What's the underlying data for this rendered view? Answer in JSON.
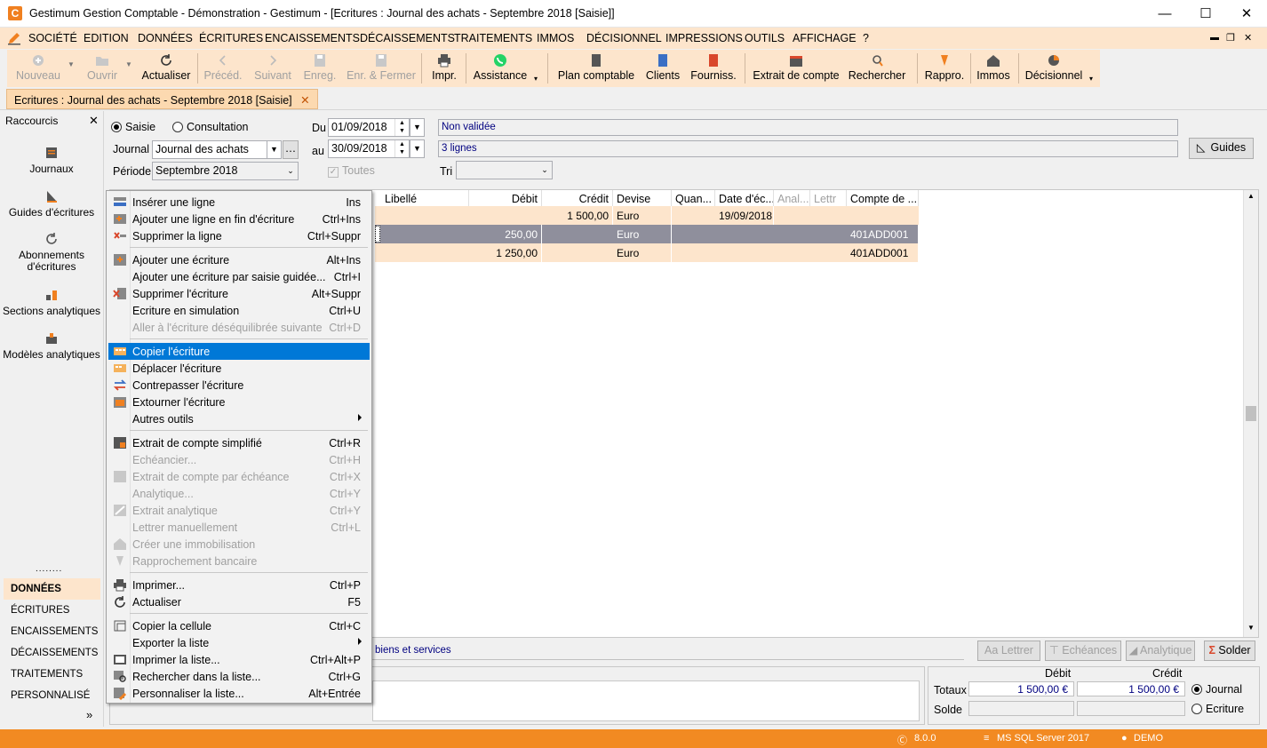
{
  "window": {
    "title": "Gestimum Gestion Comptable - Démonstration - Gestimum - [Ecritures : Journal des achats - Septembre 2018 [Saisie]]",
    "minimize": "—",
    "maximize": "☐",
    "close": "✕"
  },
  "menu": {
    "items": [
      "SOCIÉTÉ",
      "EDITION",
      "DONNÉES",
      "ÉCRITURES",
      "ENCAISSEMENTS",
      "DÉCAISSEMENTS",
      "TRAITEMENTS",
      "IMMOS",
      "DÉCISIONNEL",
      "IMPRESSIONS",
      "OUTILS",
      "AFFICHAGE",
      "?"
    ],
    "right_controls": [
      "✕",
      "❐",
      "✕"
    ]
  },
  "toolbar": {
    "nouveau": "Nouveau",
    "ouvrir": "Ouvrir",
    "actualiser": "Actualiser",
    "preced": "Précéd.",
    "suivant": "Suivant",
    "enreg": "Enreg.",
    "enreg_fermer": "Enr. & Fermer",
    "impr": "Impr.",
    "assistance": "Assistance",
    "plan_comptable": "Plan comptable",
    "clients": "Clients",
    "fourniss": "Fourniss.",
    "extrait": "Extrait de compte",
    "rechercher": "Rechercher",
    "rappro": "Rappro.",
    "immos": "Immos",
    "decisionnel": "Décisionnel"
  },
  "doc_tab": {
    "label": "Ecritures : Journal des achats - Septembre 2018 [Saisie]",
    "close": "✕"
  },
  "shortcuts": {
    "header": "Raccourcis",
    "close": "✕",
    "items": [
      "Journaux",
      "Guides d'écritures",
      "Abonnements d'écritures",
      "Sections analytiques",
      "Modèles analytiques"
    ],
    "dots": "........",
    "nav": [
      "DONNÉES",
      "ÉCRITURES",
      "ENCAISSEMENTS",
      "DÉCAISSEMENTS",
      "TRAITEMENTS",
      "PERSONNALISÉ"
    ],
    "more": "»"
  },
  "form": {
    "saisie": "Saisie",
    "consultation": "Consultation",
    "journal_label": "Journal",
    "journal_value": "Journal des achats",
    "periode_label": "Période",
    "periode_value": "Septembre 2018",
    "du_label": "Du",
    "du_value": "01/09/2018",
    "au_label": "au",
    "au_value": "30/09/2018",
    "toutes": "Toutes",
    "tri_label": "Tri",
    "status": "Non validée",
    "lines": "3 lignes",
    "guides": "Guides"
  },
  "grid": {
    "columns": [
      "Libellé",
      "Débit",
      "Crédit",
      "Devise",
      "Quan...",
      "Date d'éc...",
      "Anal...",
      "Lettr",
      "Compte de ..."
    ],
    "rows": [
      {
        "debit": "",
        "credit": "1 500,00",
        "devise": "Euro",
        "date": "19/09/2018",
        "compte": ""
      },
      {
        "debit": "250,00",
        "credit": "",
        "devise": "Euro",
        "date": "",
        "compte": "401ADD001"
      },
      {
        "debit": "1 250,00",
        "credit": "",
        "devise": "Euro",
        "date": "",
        "compte": "401ADD001"
      }
    ]
  },
  "bottom": {
    "account_label": "biens et services",
    "lettrer": "Lettrer",
    "echeances": "Echéances",
    "analytique": "Analytique",
    "solder": "Solder",
    "debit_head": "Débit",
    "credit_head": "Crédit",
    "totaux": "Totaux",
    "solde": "Solde",
    "total_debit": "1 500,00 €",
    "total_credit": "1 500,00 €",
    "journal": "Journal",
    "ecriture": "Ecriture"
  },
  "context_menu": [
    {
      "label": "Insérer une ligne",
      "key": "Ins",
      "enabled": true
    },
    {
      "label": "Ajouter une ligne en fin d'écriture",
      "key": "Ctrl+Ins",
      "enabled": true
    },
    {
      "label": "Supprimer la ligne",
      "key": "Ctrl+Suppr",
      "enabled": true
    },
    {
      "label": "Ajouter une écriture",
      "key": "Alt+Ins",
      "enabled": true
    },
    {
      "label": "Ajouter une écriture par saisie guidée...",
      "key": "Ctrl+I",
      "enabled": true
    },
    {
      "label": "Supprimer l'écriture",
      "key": "Alt+Suppr",
      "enabled": true
    },
    {
      "label": "Ecriture en simulation",
      "key": "Ctrl+U",
      "enabled": true
    },
    {
      "label": "Aller à l'écriture déséquilibrée suivante",
      "key": "Ctrl+D",
      "enabled": false
    },
    {
      "label": "Copier l'écriture",
      "key": "",
      "enabled": true,
      "highlighted": true
    },
    {
      "label": "Déplacer l'écriture",
      "key": "",
      "enabled": true
    },
    {
      "label": "Contrepasser l'écriture",
      "key": "",
      "enabled": true
    },
    {
      "label": "Extourner l'écriture",
      "key": "",
      "enabled": true
    },
    {
      "label": "Autres outils",
      "key": "",
      "enabled": true,
      "submenu": true
    },
    {
      "label": "Extrait de compte simplifié",
      "key": "Ctrl+R",
      "enabled": true
    },
    {
      "label": "Echéancier...",
      "key": "Ctrl+H",
      "enabled": false
    },
    {
      "label": "Extrait de compte par échéance",
      "key": "Ctrl+X",
      "enabled": false
    },
    {
      "label": "Analytique...",
      "key": "Ctrl+Y",
      "enabled": false
    },
    {
      "label": "Extrait analytique",
      "key": "Ctrl+Y",
      "enabled": false
    },
    {
      "label": "Lettrer manuellement",
      "key": "Ctrl+L",
      "enabled": false
    },
    {
      "label": "Créer une immobilisation",
      "key": "",
      "enabled": false
    },
    {
      "label": "Rapprochement bancaire",
      "key": "",
      "enabled": false
    },
    {
      "label": "Imprimer...",
      "key": "Ctrl+P",
      "enabled": true
    },
    {
      "label": "Actualiser",
      "key": "F5",
      "enabled": true
    },
    {
      "label": "Copier la cellule",
      "key": "Ctrl+C",
      "enabled": true
    },
    {
      "label": "Exporter la liste",
      "key": "",
      "enabled": true,
      "submenu": true
    },
    {
      "label": "Imprimer la liste...",
      "key": "Ctrl+Alt+P",
      "enabled": true
    },
    {
      "label": "Rechercher dans la liste...",
      "key": "Ctrl+G",
      "enabled": true
    },
    {
      "label": "Personnaliser la liste...",
      "key": "Alt+Entrée",
      "enabled": true
    }
  ],
  "status": {
    "version": "8.0.0",
    "server": "MS SQL Server 2017",
    "db": "DEMO"
  },
  "colors": {
    "accent": "#f28a22",
    "menu_bg": "#fde5cc",
    "highlight": "#0078d7",
    "selected_row": "#8f8f9c"
  }
}
